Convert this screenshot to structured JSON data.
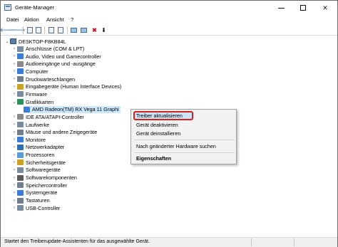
{
  "window": {
    "title": "Geräte-Manager",
    "controls": {
      "minimize": "—",
      "maximize": "☐",
      "close": "✕"
    }
  },
  "menu": [
    "Datei",
    "Aktion",
    "Ansicht",
    "?"
  ],
  "toolbar": {
    "back": "🡐",
    "forward": "🡒",
    "scan": "🖳",
    "uninstall": "✖",
    "update": "⬇"
  },
  "tree": {
    "root": "DESKTOP-F8KB84L",
    "items": [
      {
        "label": "Anschlüsse (COM & LPT)",
        "expanded": false
      },
      {
        "label": "Audio, Video und Gamecontroller",
        "expanded": false
      },
      {
        "label": "Audioeingänge und -ausgänge",
        "expanded": false
      },
      {
        "label": "Computer",
        "expanded": false
      },
      {
        "label": "Druckwarteschlangen",
        "expanded": false
      },
      {
        "label": "Eingabegeräte (Human Interface Devices)",
        "expanded": false
      },
      {
        "label": "Firmware",
        "expanded": false
      },
      {
        "label": "Grafikkarten",
        "expanded": true
      },
      {
        "label": "AMD Radeon(TM) RX Vega 11 Graphi",
        "child": true,
        "selected": true
      },
      {
        "label": "IDE ATA/ATAPI-Controller",
        "expanded": false
      },
      {
        "label": "Laufwerke",
        "expanded": false
      },
      {
        "label": "Mäuse und andere Zeigegeräte",
        "expanded": false
      },
      {
        "label": "Monitore",
        "expanded": false
      },
      {
        "label": "Netzwerkadapter",
        "expanded": false
      },
      {
        "label": "Prozessoren",
        "expanded": false
      },
      {
        "label": "Sicherheitsgeräte",
        "expanded": false
      },
      {
        "label": "Softwaregeräte",
        "expanded": false
      },
      {
        "label": "Softwarekomponenten",
        "expanded": false
      },
      {
        "label": "Speichercontroller",
        "expanded": false
      },
      {
        "label": "Systemgeräte",
        "expanded": false
      },
      {
        "label": "Tastaturen",
        "expanded": false
      },
      {
        "label": "USB-Controller",
        "expanded": false
      }
    ]
  },
  "context_menu": {
    "items": [
      "Treiber aktualisieren",
      "Gerät deaktivieren",
      "Gerät deinstallieren",
      "Nach geänderter Hardware suchen",
      "Eigenschaften"
    ],
    "highlighted": "Treiber aktualisieren",
    "highlight_border_color": "#d42020"
  },
  "status": "Startet den Treiberupdate-Assistenten für das ausgewählte Gerät.",
  "colors": {
    "selection": "#cce8ff",
    "menu_hover": "#cce4f7",
    "accent_red": "#d42020"
  }
}
